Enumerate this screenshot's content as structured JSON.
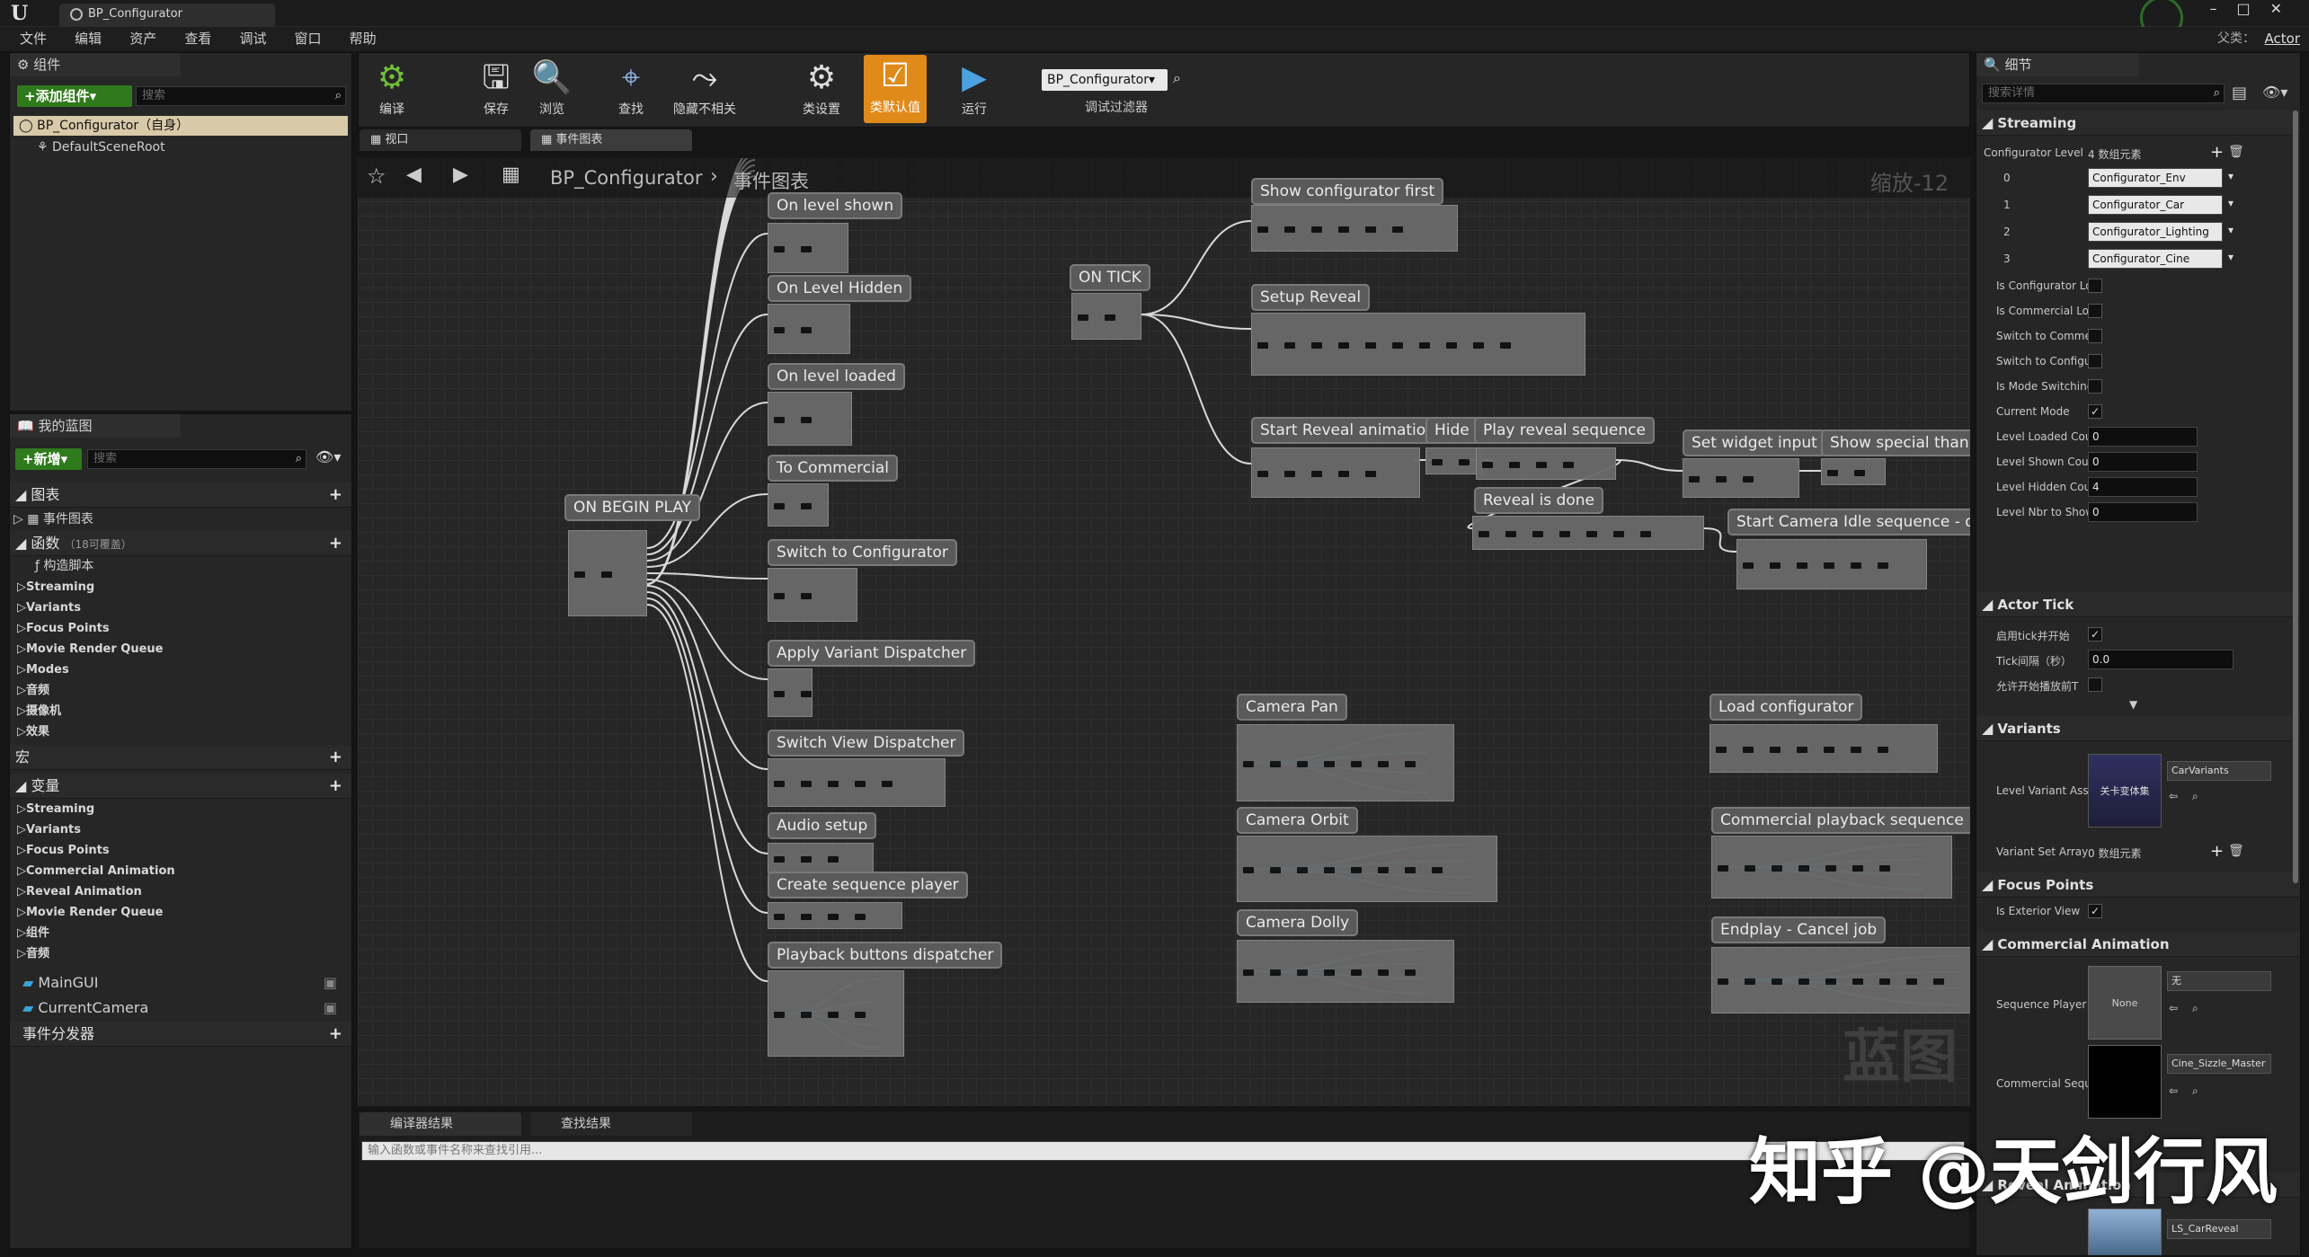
{
  "window": {
    "tab_title": "BP_Configurator",
    "parent_label": "父类：",
    "parent_value": "Actor"
  },
  "menu": [
    "文件",
    "编辑",
    "资产",
    "查看",
    "调试",
    "窗口",
    "帮助"
  ],
  "components": {
    "header": "组件",
    "add_button": "+添加组件▾",
    "search_placeholder": "搜索",
    "root": "BP_Configurator（自身）",
    "child": "DefaultSceneRoot"
  },
  "myblueprint": {
    "header": "我的蓝图",
    "new_button": "+新增▾",
    "search_placeholder": "搜索",
    "graphs_label": "图表",
    "event_graph": "事件图表",
    "functions_label": "函数",
    "functions_count": "（18可覆盖）",
    "construction": "构造脚本",
    "function_items": [
      "Streaming",
      "Variants",
      "Focus Points",
      "Movie Render Queue",
      "Modes",
      "音频",
      "摄像机",
      "效果"
    ],
    "macros_label": "宏",
    "variables_label": "变量",
    "variable_items": [
      "Streaming",
      "Variants",
      "Focus Points",
      "Commercial Animation",
      "Reveal Animation",
      "Movie Render Queue",
      "组件",
      "音频"
    ],
    "vars": [
      "MainGUI",
      "CurrentCamera"
    ],
    "dispatchers_label": "事件分发器"
  },
  "toolbar": {
    "compile": "编译",
    "save": "保存",
    "browse": "浏览",
    "find": "查找",
    "hide": "隐藏不相关",
    "class_settings": "类设置",
    "class_defaults": "类默认值",
    "run": "运行",
    "debug_object": "BP_Configurator▾",
    "debug_filter": "调试过滤器"
  },
  "editor_tabs": {
    "viewport": "视口",
    "event_graph": "事件图表"
  },
  "breadcrumb": {
    "root": "BP_Configurator",
    "sep": "›",
    "current": "事件图表",
    "zoom": "缩放-12"
  },
  "nodes": [
    {
      "title": "On level shown"
    },
    {
      "title": "On Level Hidden"
    },
    {
      "title": "On level loaded"
    },
    {
      "title": "To Commercial"
    },
    {
      "title": "Switch to Configurator"
    },
    {
      "title": "Apply Variant Dispatcher"
    },
    {
      "title": "Switch View Dispatcher"
    },
    {
      "title": "Audio setup"
    },
    {
      "title": "Create sequence player"
    },
    {
      "title": "Playback buttons dispatcher"
    },
    {
      "title": "ON BEGIN PLAY"
    },
    {
      "title": "ON TICK"
    },
    {
      "title": "Show configurator first"
    },
    {
      "title": "Setup Reveal"
    },
    {
      "title": "Start Reveal animation"
    },
    {
      "title": "Hide loading"
    },
    {
      "title": "Play reveal sequence"
    },
    {
      "title": "Set widget input"
    },
    {
      "title": "Show special thanks"
    },
    {
      "title": "Reveal is done"
    },
    {
      "title": "Start Camera Idle sequence - dispatch"
    },
    {
      "title": "Camera Pan"
    },
    {
      "title": "Camera Orbit"
    },
    {
      "title": "Camera Dolly"
    },
    {
      "title": "Load configurator"
    },
    {
      "title": "Commercial playback sequence"
    },
    {
      "title": "Endplay - Cancel job"
    }
  ],
  "graph_watermark": "蓝图",
  "bottom": {
    "compiler_tab": "编译器结果",
    "find_tab": "查找结果",
    "find_placeholder": "输入函数或事件名称来查找引用..."
  },
  "details": {
    "header": "细节",
    "search_placeholder": "搜索详情",
    "streaming": {
      "title": "Streaming",
      "array_label": "Configurator Levels",
      "array_count": "4 数组元素",
      "elements": [
        {
          "idx": "0",
          "val": "Configurator_Env"
        },
        {
          "idx": "1",
          "val": "Configurator_Car"
        },
        {
          "idx": "2",
          "val": "Configurator_Lighting"
        },
        {
          "idx": "3",
          "val": "Configurator_Cine"
        }
      ],
      "bools": [
        {
          "label": "Is Configurator Loaded",
          "checked": false
        },
        {
          "label": "Is Commercial Loaded",
          "checked": false
        },
        {
          "label": "Switch to Commercial",
          "checked": false
        },
        {
          "label": "Switch to Configurator",
          "checked": false
        },
        {
          "label": "Is Mode Switching",
          "checked": false
        },
        {
          "label": "Current Mode",
          "checked": true
        }
      ],
      "nums": [
        {
          "label": "Level Loaded Count",
          "val": "0"
        },
        {
          "label": "Level Shown Count",
          "val": "0"
        },
        {
          "label": "Level Hidden Count",
          "val": "4"
        },
        {
          "label": "Level Nbr to Show",
          "val": "0"
        }
      ]
    },
    "actor_tick": {
      "title": "Actor Tick",
      "start_tick": "启用tick并开始",
      "tick_interval": "Tick间隔（秒）",
      "tick_interval_val": "0.0",
      "allow_before": "允许开始播放前T"
    },
    "variants": {
      "title": "Variants",
      "level_variant_label": "Level Variant Asset",
      "thumb_label": "关卡变体集",
      "level_variant_val": "CarVariants",
      "variant_set_label": "Variant Set Array",
      "variant_set_count": "0 数组元素"
    },
    "focus_points": {
      "title": "Focus Points",
      "exterior_label": "Is Exterior View"
    },
    "commercial": {
      "title": "Commercial Animation",
      "player_label": "Sequence Player",
      "player_thumb": "None",
      "player_val": "无",
      "seq_label": "Commercial Sequence",
      "seq_val": "Cine_Sizzle_Master"
    },
    "reveal": {
      "title": "Reveal Animation",
      "seq_val": "LS_CarReveal"
    }
  },
  "watermark": "知乎 @天剑行风"
}
